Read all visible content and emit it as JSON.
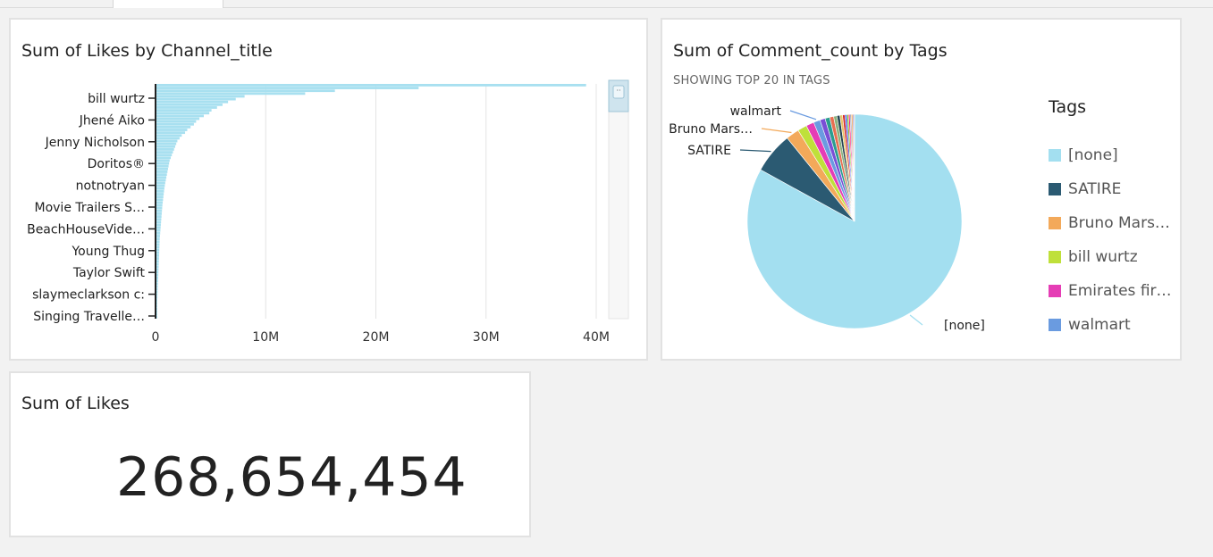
{
  "tabs": [
    {
      "label": ""
    },
    {
      "label": ""
    }
  ],
  "visuals": {
    "bar": {
      "title": "Sum of Likes by Channel_title"
    },
    "pie": {
      "title": "Sum of Comment_count by Tags",
      "subtitle": "SHOWING TOP 20 IN TAGS",
      "legend_title": "Tags",
      "legend": [
        {
          "label": "[none]",
          "color": "#a3dff0"
        },
        {
          "label": "SATIRE",
          "color": "#2b5a72"
        },
        {
          "label": "Bruno Mars…",
          "color": "#f3a95a"
        },
        {
          "label": "bill wurtz",
          "color": "#bfe03a"
        },
        {
          "label": "Emirates fir…",
          "color": "#e53db5"
        },
        {
          "label": "walmart",
          "color": "#6a9be0"
        }
      ]
    },
    "kpi": {
      "title": "Sum of Likes",
      "value": "268,654,454"
    }
  },
  "chart_data": [
    {
      "type": "bar",
      "orientation": "horizontal",
      "title": "Sum of Likes by Channel_title",
      "xlim": [
        0,
        42000000
      ],
      "x_ticks": [
        "0",
        "10M",
        "20M",
        "30M",
        "40M"
      ],
      "tick_values": [
        0,
        10000000,
        20000000,
        30000000,
        40000000
      ],
      "category_labels_shown": [
        "bill wurtz",
        "Jhené Aiko",
        "Jenny Nicholson",
        "Doritos®",
        "notnotryan",
        "Movie Trailers S…",
        "BeachHouseVide…",
        "Young Thug",
        "Taylor Swift",
        "slaymeclarkson c:",
        "Singing Travelle…"
      ],
      "values": [
        39000000,
        23800000,
        16200000,
        13500000,
        8000000,
        7200000,
        6500000,
        6000000,
        5500000,
        5000000,
        4800000,
        4300000,
        3900000,
        3600000,
        3400000,
        3100000,
        2800000,
        2600000,
        2300000,
        2100000,
        1900000,
        1800000,
        1700000,
        1600000,
        1500000,
        1400000,
        1300000,
        1200000,
        1150000,
        1100000,
        1050000,
        1000000,
        950000,
        900000,
        850000,
        800000,
        760000,
        720000,
        690000,
        660000,
        630000,
        600000,
        570000,
        540000,
        520000,
        500000,
        480000,
        460000,
        440000,
        420000,
        400000,
        380000,
        360000,
        340000,
        320000,
        300000,
        290000,
        280000,
        270000,
        260000,
        250000,
        240000,
        230000,
        220000,
        210000,
        200000,
        190000,
        180000,
        170000,
        160000,
        150000,
        140000,
        130000,
        120000,
        110000,
        100000,
        90000,
        80000,
        70000,
        60000,
        50000,
        40000,
        30000,
        20000
      ],
      "bar_color": "#a8e0f0"
    },
    {
      "type": "pie",
      "title": "Sum of Comment_count by Tags",
      "subtitle": "SHOWING TOP 20 IN TAGS",
      "legend_title": "Tags",
      "slices": [
        {
          "label": "[none]",
          "value": 83.3,
          "color": "#a3dff0",
          "show_label": true
        },
        {
          "label": "SATIRE",
          "value": 6.2,
          "color": "#2b5a72",
          "show_label": true
        },
        {
          "label": "Bruno Mars…",
          "value": 2.0,
          "color": "#f3a95a",
          "show_label": true
        },
        {
          "label": "bill wurtz",
          "value": 1.4,
          "color": "#bfe03a",
          "show_label": false
        },
        {
          "label": "Emirates fir…",
          "value": 1.2,
          "color": "#e53db5",
          "show_label": false
        },
        {
          "label": "walmart",
          "value": 1.0,
          "color": "#6a9be0",
          "show_label": true
        },
        {
          "label": "",
          "value": 0.8,
          "color": "#7a4fd6"
        },
        {
          "label": "",
          "value": 0.7,
          "color": "#2a9d8f"
        },
        {
          "label": "",
          "value": 0.6,
          "color": "#e76f51"
        },
        {
          "label": "",
          "value": 0.5,
          "color": "#8ab17d"
        },
        {
          "label": "",
          "value": 0.45,
          "color": "#264653"
        },
        {
          "label": "",
          "value": 0.4,
          "color": "#e9c46a"
        },
        {
          "label": "",
          "value": 0.35,
          "color": "#d62828"
        },
        {
          "label": "",
          "value": 0.3,
          "color": "#4361ee"
        },
        {
          "label": "",
          "value": 0.25,
          "color": "#80b918"
        },
        {
          "label": "",
          "value": 0.22,
          "color": "#ff006e"
        },
        {
          "label": "",
          "value": 0.2,
          "color": "#8d99ae"
        },
        {
          "label": "",
          "value": 0.18,
          "color": "#f77f00"
        },
        {
          "label": "",
          "value": 0.16,
          "color": "#5e60ce"
        },
        {
          "label": "",
          "value": 0.14,
          "color": "#c9ada7"
        }
      ]
    }
  ]
}
